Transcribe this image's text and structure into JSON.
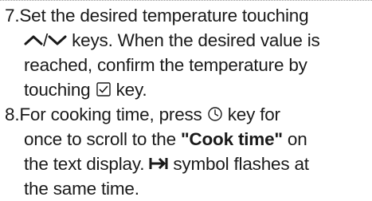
{
  "step7": {
    "number": "7.",
    "line1": "Set the desired temperature touching",
    "icons_desc": [
      "arrow-up-icon",
      "arrow-down-icon"
    ],
    "separator": "/",
    "line2_text": " keys. When the desired value is",
    "line3": "reached, confirm the temperature by",
    "line4_pre": "touching ",
    "line4_post": " key."
  },
  "step8": {
    "number": "8.",
    "line1_pre": "For cooking time, press ",
    "line1_post": " key for",
    "line2_pre": "once to scroll to the ",
    "cook_time_label": "\"Cook time\"",
    "line2_post": " on",
    "line3_pre": "the text display. ",
    "line3_post": " symbol flashes at",
    "line4": "the same time."
  },
  "colors": {
    "text": "#1a1a1a",
    "rule": "#9a9a9a"
  }
}
